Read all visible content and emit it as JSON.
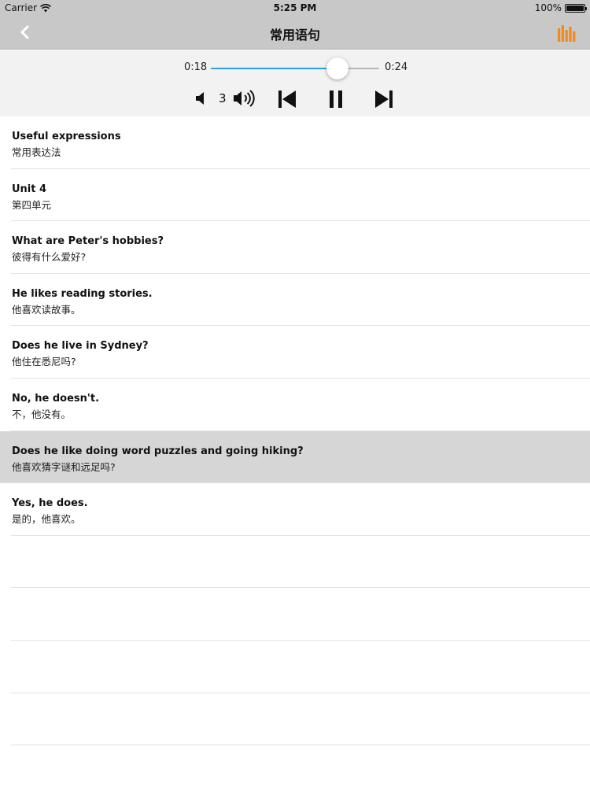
{
  "status_bar": {
    "carrier": "Carrier",
    "time": "5:25 PM",
    "battery": "100%"
  },
  "nav": {
    "title": "常用语句",
    "accent_color": "#f08a1c"
  },
  "player": {
    "current_time": "0:18",
    "total_time": "0:24",
    "progress": 0.75,
    "volume": "3",
    "accent_color": "#2b9fe0"
  },
  "sentences": [
    {
      "en": "Useful expressions",
      "zh": "常用表达法"
    },
    {
      "en": "Unit 4",
      "zh": "第四单元"
    },
    {
      "en": "What are Peter's hobbies?",
      "zh": "彼得有什么爱好?"
    },
    {
      "en": "He likes reading stories.",
      "zh": "他喜欢读故事。"
    },
    {
      "en": "Does he live in Sydney?",
      "zh": "他住在悉尼吗?"
    },
    {
      "en": "No, he doesn't.",
      "zh": "不，他没有。"
    },
    {
      "en": "Does he like doing word puzzles and going hiking?",
      "zh": "他喜欢猜字谜和远足吗?"
    },
    {
      "en": "Yes, he does.",
      "zh": "是的，他喜欢。"
    }
  ],
  "active_index": 6,
  "icons": [
    "wifi-icon",
    "battery-icon",
    "back-chevron-icon",
    "equalizer-icon",
    "volume-low-icon",
    "volume-high-icon",
    "skip-previous-icon",
    "pause-icon",
    "skip-next-icon"
  ]
}
